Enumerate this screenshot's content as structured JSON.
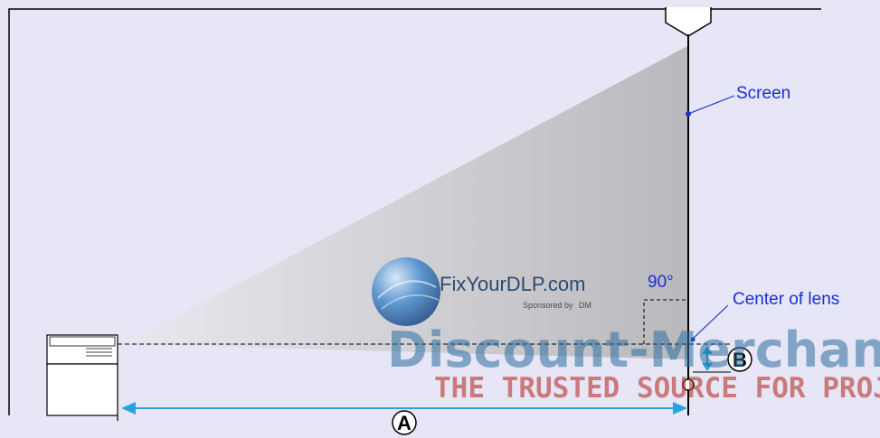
{
  "labels": {
    "screen": "Screen",
    "angle": "90°",
    "center_of_lens": "Center of lens",
    "distance_a": "A",
    "offset_b": "B"
  },
  "watermark": {
    "site": "FixYourDLP.com",
    "sponsor": "Sponsored by",
    "sponsor_logo": "DM",
    "brand": "Discount-Merchant",
    "tagline": "THE TRUSTED SOURCE FOR PROJ"
  },
  "colors": {
    "background": "#e6e6f6",
    "accent_blue": "#1a2fd6",
    "arrow_cyan": "#29a3e0",
    "beam_gray": "#c8c8c8"
  }
}
